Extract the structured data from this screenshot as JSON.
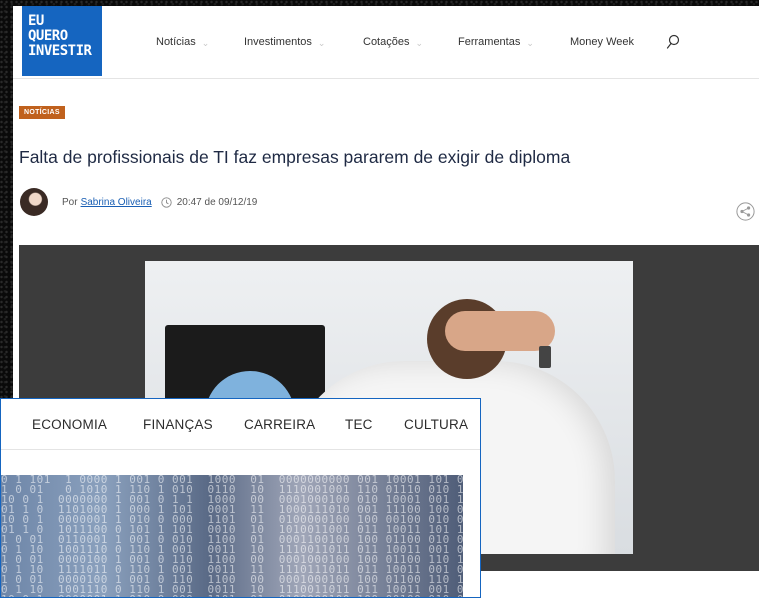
{
  "site": {
    "logo_line1": "EU",
    "logo_line2": "QUERO",
    "logo_line3": "INVESTIR",
    "brand_color": "#1565c0"
  },
  "nav": {
    "items": [
      {
        "label": "Notícias",
        "has_dropdown": true
      },
      {
        "label": "Investimentos",
        "has_dropdown": true
      },
      {
        "label": "Cotações",
        "has_dropdown": true
      },
      {
        "label": "Ferramentas",
        "has_dropdown": true
      },
      {
        "label": "Money Week",
        "has_dropdown": false
      }
    ],
    "search_icon": "search-icon"
  },
  "article": {
    "category_badge": "NOTÍCIAS",
    "badge_color": "#c0611d",
    "headline": "Falta de profissionais de TI faz empresas pararem de exigir de diploma",
    "byline_prefix": "Por",
    "author": "Sabrina Oliveira",
    "datetime": "20:47 de 09/12/19",
    "share_icon": "share-icon",
    "clock_icon": "clock-icon"
  },
  "overlay_site": {
    "nav_items": [
      "ECONOMIA",
      "FINANÇAS",
      "CARREIRA",
      "TEC",
      "CULTURA"
    ],
    "border_color": "#1565c0"
  },
  "matrix_lines": [
    "0 1 101  1 0000 1 001 0 001  1000  01  0000000000 001 10001 101 000",
    "1 0 01   0 1010 1 110 1 010  0110  10  1110001001 110 01110 010 101",
    "10 0 1  0000000 1 001 0 1 1  1000  00  0001000100 010 10001 001 110",
    "01 1 0  1101000 1 000 1 101  0001  11  1000111010 001 11100 100 001",
    "10 0 1  0000001 1 010 0 000  1101  01  0100000100 100 00100 010 010",
    "01 1 0  1011100 0 101 1 101  0010  10  1010011001 011 10011 101 101",
    "1 0 01  0110001 1 001 0 010  1100  01  0001100100 100 01100 010 000",
    "0 1 10  1001110 0 110 1 001  0011  10  1110011011 011 10011 001 011",
    "1 0 01  0000100 1 001 0 110  1100  00  0001000100 100 01100 110 100",
    "0 1 10  1111011 0 110 1 001  0011  11  1110111011 011 10011 001 011",
    "1 0 01  0000100 1 001 0 110  1100  00  0001000100 100 01100 110 100",
    "0 1 10  1001110 0 110 1 001  0011  10  1110011011 011 10011 001 011",
    "10 0 1  0000001 1 010 0 000  1101  01  0100000100 100 00100 010 010"
  ]
}
